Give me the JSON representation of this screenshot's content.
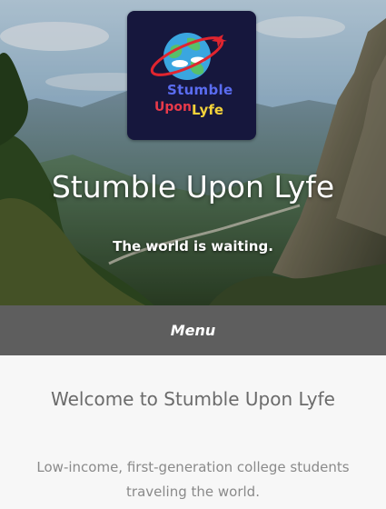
{
  "site": {
    "logo": {
      "line1": "Stumble",
      "line2a": "Upon",
      "line2b": "Lyfe"
    },
    "title": "Stumble Upon Lyfe",
    "tagline": "The world is waiting."
  },
  "nav": {
    "menu_label": "Menu"
  },
  "main": {
    "heading": "Welcome to Stumble Upon Lyfe",
    "intro": "Low-income, first-generation college students traveling the world."
  },
  "colors": {
    "menu_bar": "#5e5e5e",
    "logo_bg": "#16173d",
    "logo_ring": "#e0252f",
    "content_bg": "#f7f7f7",
    "heading_text": "#6b6b6b"
  },
  "icons": {
    "logo_globe": "globe-with-airplane-icon"
  }
}
